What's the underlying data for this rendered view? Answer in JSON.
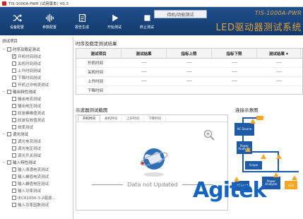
{
  "window": {
    "title": "TIS-1000A-PWR (试用版本) V0.3"
  },
  "toolbar": {
    "buttons": [
      {
        "label": "设备配置",
        "icon": "shuffle-icon"
      },
      {
        "label": "参数配置",
        "icon": "equalizer-icon"
      },
      {
        "label": "报告生成",
        "icon": "report-icon"
      },
      {
        "label": "开始测试",
        "icon": "play-icon"
      },
      {
        "label": "终止测试",
        "icon": "stop-icon"
      }
    ],
    "status": "待机/功能测试"
  },
  "brand": {
    "model": "TIS-1000A-PWR",
    "title": "LED驱动器测试系统"
  },
  "sidebar": {
    "header": "测试项目",
    "groups": [
      {
        "label": "时序及稳定测试",
        "items": [
          "开机时间测试",
          "关机时间测试",
          "上升时间测试",
          "下降时间测试",
          "开机过冲电流测试"
        ]
      },
      {
        "label": "输出特性测试",
        "items": [
          "输出电流测试",
          "输出电压测试",
          "纹波峰峰值测试",
          "纹波有效值测试",
          "效率测试"
        ]
      },
      {
        "label": "调光测试",
        "items": [
          "调光电流测试",
          "调光电压测试",
          "调光开关测试"
        ]
      },
      {
        "label": "输入特性测试",
        "items": [
          "输入浪涌电流测试",
          "输入峰值电流测试",
          "输入峰值电压测试",
          "输入功率测试",
          "IEC61000-3-2谐波...",
          "输入功率因数测试"
        ]
      }
    ]
  },
  "results": {
    "title": "时序及稳定测试结果",
    "columns": [
      "测试项目",
      "测试结果",
      "指标上限",
      "指标下限",
      "测试结果"
    ],
    "rows": [
      [
        "开机时间",
        "----",
        "----",
        "----",
        "----"
      ],
      [
        "关机时间",
        "----",
        "----",
        "----",
        "----"
      ],
      [
        "上升时间",
        "----",
        "----",
        "----",
        "----"
      ],
      [
        "下降时间",
        "",
        "",
        "",
        ""
      ]
    ]
  },
  "waveform": {
    "title": "示波器测试截图",
    "tabs": [
      "开机时间",
      "关机时间",
      "上升时间",
      "下降时间"
    ],
    "empty_message": "Data not Updated"
  },
  "connection": {
    "title": "连接示意图",
    "blocks": [
      "AC Source",
      "Power Analyzer",
      "Scope",
      "Power Analyzer",
      "AC Load",
      "LED"
    ]
  },
  "watermark": "Agitek",
  "colors": {
    "toolbar": "#1f4f8c",
    "brand_orange": "#e8a238",
    "block_blue": "#1f5aa6",
    "warning": "#f5a623"
  }
}
